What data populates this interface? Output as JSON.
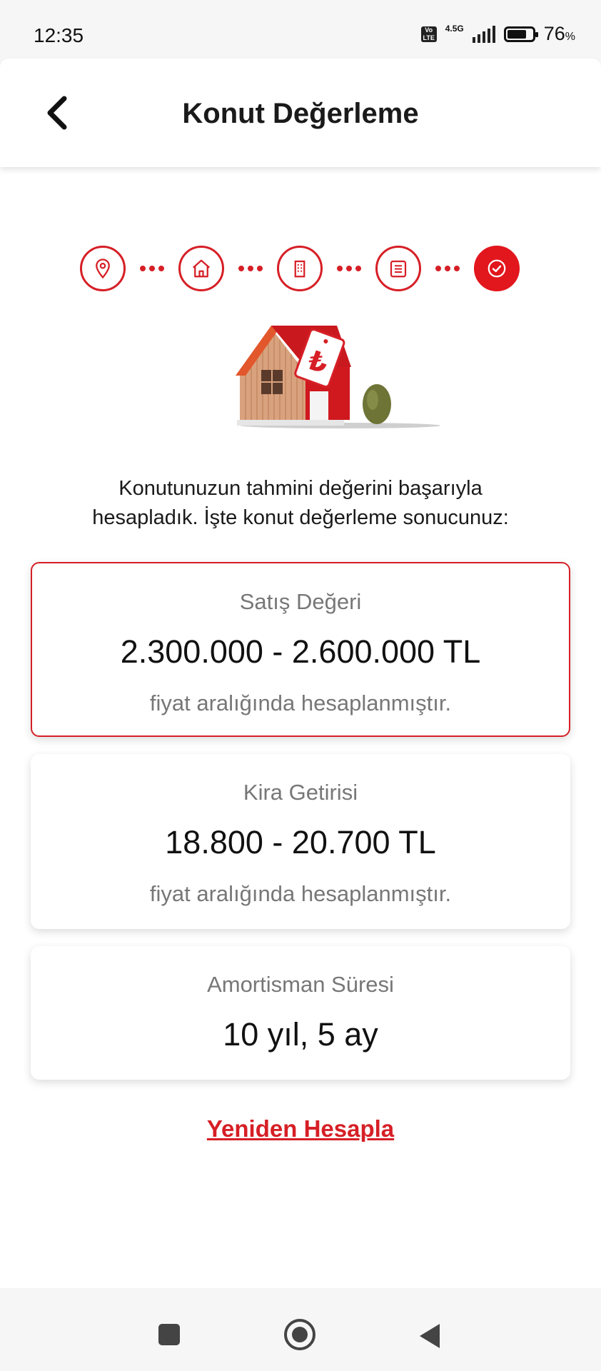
{
  "status_bar": {
    "time": "12:35",
    "network": "4.5G",
    "volte": "Vo LTE",
    "battery_percent": "76",
    "battery_unit": "%",
    "battery_level": 0.76
  },
  "header": {
    "title": "Konut Değerleme"
  },
  "steps": [
    {
      "icon": "location-pin-icon",
      "state": "done"
    },
    {
      "icon": "house-icon",
      "state": "done"
    },
    {
      "icon": "building-icon",
      "state": "done"
    },
    {
      "icon": "document-icon",
      "state": "done"
    },
    {
      "icon": "check-icon",
      "state": "active"
    }
  ],
  "illustration": {
    "currency_symbol": "₺"
  },
  "intro": {
    "line1": "Konutunuzun tahmini değerini başarıyla",
    "line2": "hesapladık. İşte konut değerleme sonucunuz:"
  },
  "cards": {
    "sale": {
      "label": "Satış Değeri",
      "value": "2.300.000 - 2.600.000 TL",
      "sub": "fiyat aralığında hesaplanmıştır."
    },
    "rent": {
      "label": "Kira Getirisi",
      "value": "18.800 - 20.700 TL",
      "sub": "fiyat aralığında hesaplanmıştır."
    },
    "amortization": {
      "label": "Amortisman Süresi",
      "value": "10 yıl, 5 ay"
    }
  },
  "recalculate": {
    "label": "Yeniden Hesapla"
  },
  "colors": {
    "accent": "#d61f26",
    "label_gray": "#777777"
  }
}
